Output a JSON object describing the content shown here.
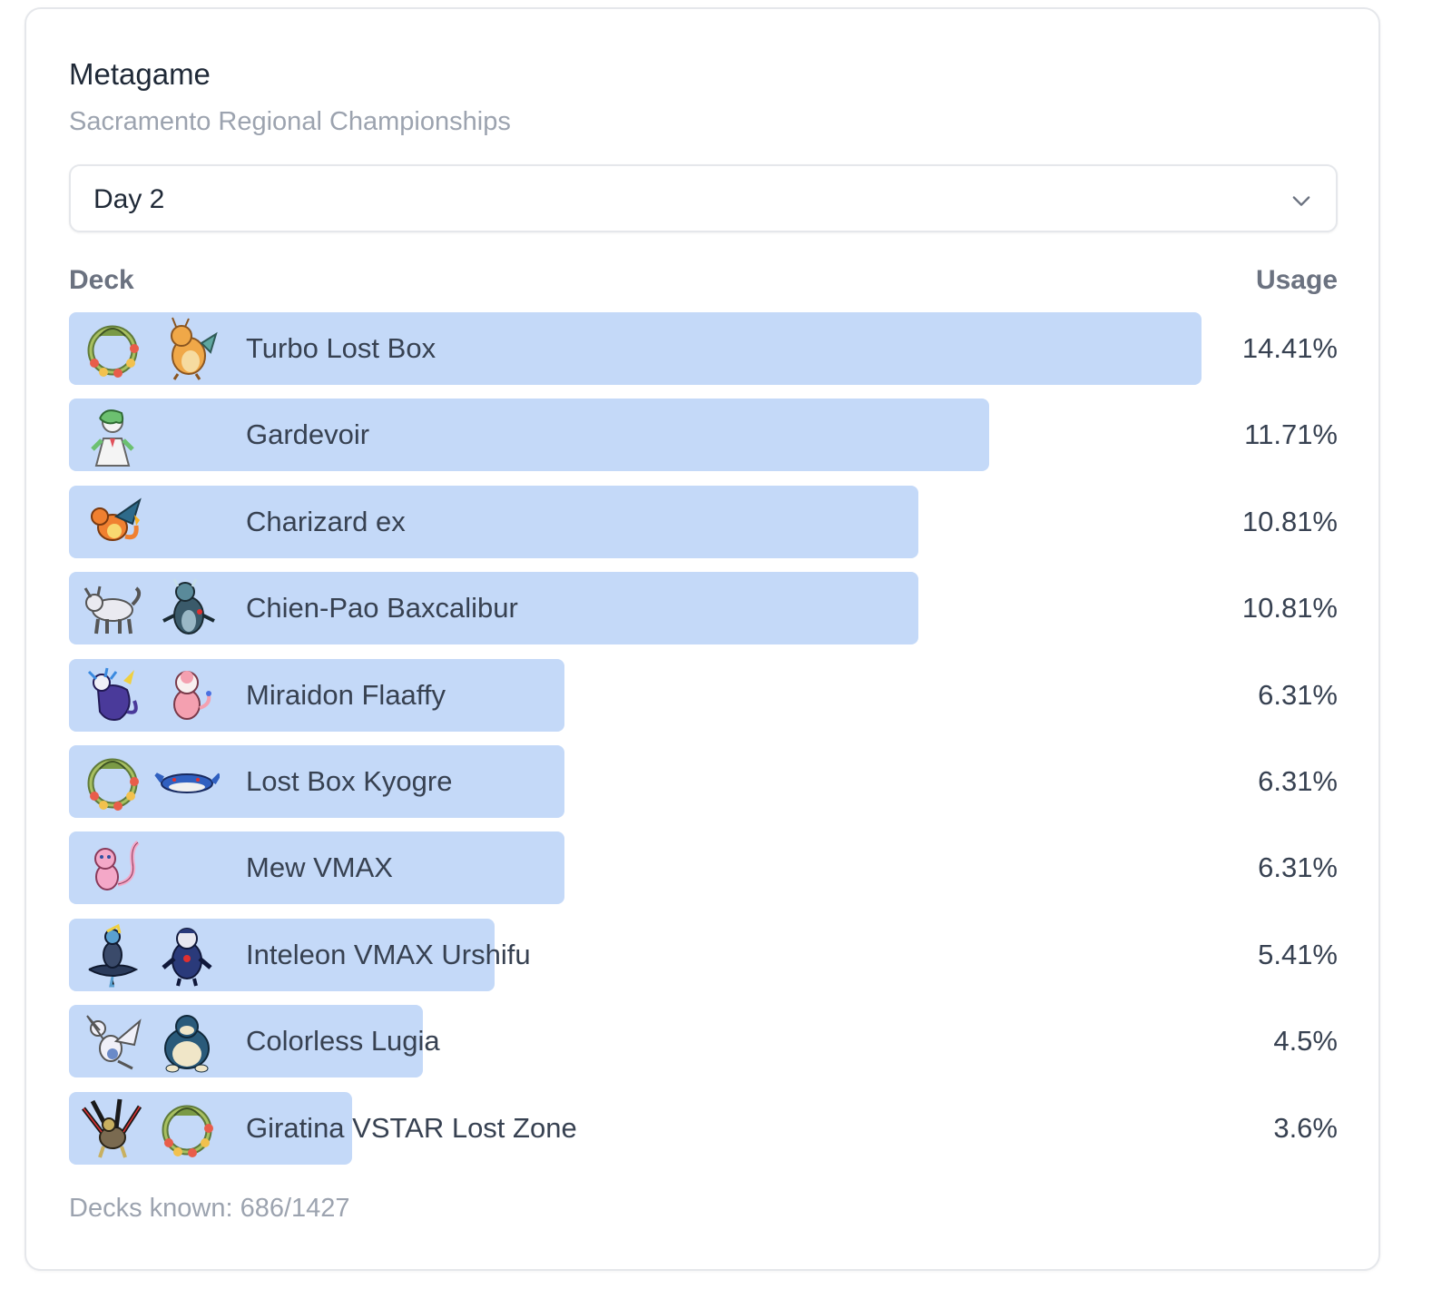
{
  "card": {
    "title": "Metagame",
    "subtitle": "Sacramento Regional Championships"
  },
  "select": {
    "value": "Day 2",
    "icon": "chevron-down-icon"
  },
  "table": {
    "deck_header": "Deck",
    "usage_header": "Usage",
    "max_percent": 14.41,
    "bar_color": "#c4d9f8",
    "rows": [
      {
        "name": "Turbo Lost Box",
        "usage": "14.41%",
        "percent": 14.41,
        "icons": [
          "comfey",
          "dragonite"
        ]
      },
      {
        "name": "Gardevoir",
        "usage": "11.71%",
        "percent": 11.71,
        "icons": [
          "gardevoir"
        ]
      },
      {
        "name": "Charizard ex",
        "usage": "10.81%",
        "percent": 10.81,
        "icons": [
          "charizard"
        ]
      },
      {
        "name": "Chien-Pao Baxcalibur",
        "usage": "10.81%",
        "percent": 10.81,
        "icons": [
          "chien-pao",
          "baxcalibur"
        ]
      },
      {
        "name": "Miraidon Flaaffy",
        "usage": "6.31%",
        "percent": 6.31,
        "icons": [
          "miraidon",
          "flaaffy"
        ]
      },
      {
        "name": "Lost Box Kyogre",
        "usage": "6.31%",
        "percent": 6.31,
        "icons": [
          "comfey",
          "kyogre"
        ]
      },
      {
        "name": "Mew VMAX",
        "usage": "6.31%",
        "percent": 6.31,
        "icons": [
          "mew"
        ]
      },
      {
        "name": "Inteleon VMAX Urshifu",
        "usage": "5.41%",
        "percent": 5.41,
        "icons": [
          "inteleon",
          "urshifu"
        ]
      },
      {
        "name": "Colorless Lugia",
        "usage": "4.5%",
        "percent": 4.5,
        "icons": [
          "lugia",
          "snorlax"
        ]
      },
      {
        "name": "Giratina VSTAR Lost Zone",
        "usage": "3.6%",
        "percent": 3.6,
        "icons": [
          "giratina",
          "comfey"
        ]
      }
    ]
  },
  "footer": {
    "decks_known": "Decks known: 686/1427"
  }
}
